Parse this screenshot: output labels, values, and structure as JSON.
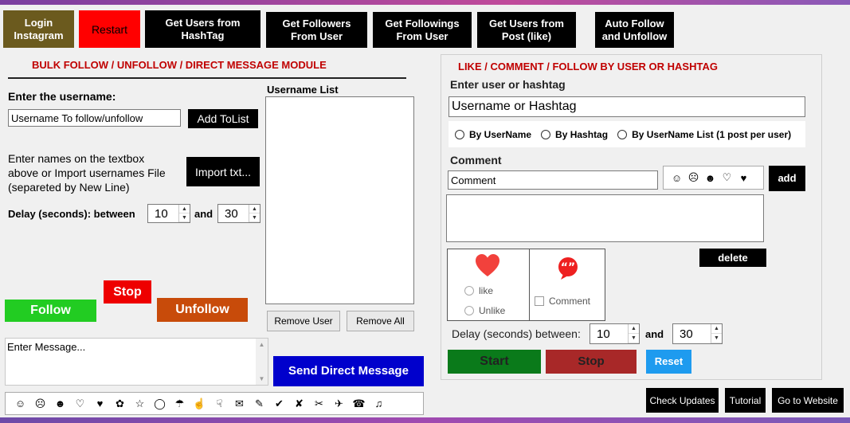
{
  "nav": {
    "login": "Login\nInstagram",
    "restart": "Restart",
    "users_hashtag": "Get Users from\nHashTag",
    "followers_user": "Get Followers\nFrom User",
    "followings_user": "Get Followings\nFrom User",
    "users_post": "Get Users from\nPost (like)",
    "auto_follow": "Auto Follow\nand Unfollow"
  },
  "bulk": {
    "heading": "BULK FOLLOW / UNFOLLOW / DIRECT MESSAGE MODULE",
    "enter_username_label": "Enter the username:",
    "username_value": "Username To follow/unfollow",
    "add_tolist": "Add ToList",
    "help_text": "Enter names on the textbox\nabove or Import usernames File\n(separeted by New Line)",
    "import_txt": "Import txt...",
    "delay_label": "Delay (seconds): between",
    "delay_from": "10",
    "and_label": "and",
    "delay_to": "30",
    "username_list_label": "Username List",
    "stop": "Stop",
    "follow": "Follow",
    "unfollow": "Unfollow",
    "remove_user": "Remove User",
    "remove_all": "Remove All",
    "message_value": "Enter Message...",
    "send_dm": "Send Direct Message",
    "emojis": [
      "☺",
      "☹",
      "☻",
      "♡",
      "♥",
      "✿",
      "☆",
      "◯",
      "☂",
      "☝",
      "☟",
      "✉",
      "✎",
      "✔",
      "✘",
      "✂",
      "✈",
      "☎",
      "♫"
    ]
  },
  "like": {
    "heading": "LIKE / COMMENT / FOLLOW BY USER OR HASHTAG",
    "enter_label": "Enter user or hashtag",
    "user_hashtag_value": "Username or Hashtag",
    "radio_username": "By UserName",
    "radio_hashtag": "By Hashtag",
    "radio_userlist": "By UserName List (1 post per user)",
    "comment_label": "Comment",
    "comment_value": "Comment",
    "comment_emojis": [
      "☺",
      "☹",
      "☻",
      "♡",
      "♥"
    ],
    "add": "add",
    "delete": "delete",
    "like_opt": "like",
    "unlike_opt": "Unlike",
    "comment_opt": "Comment",
    "delay_label": "Delay (seconds) between:",
    "delay_from": "10",
    "and_label": "and",
    "delay_to": "30",
    "start": "Start",
    "stop": "Stop",
    "reset": "Reset"
  },
  "footer": {
    "check_updates": "Check Updates",
    "tutorial": "Tutorial",
    "website": "Go to Website"
  },
  "colors": {
    "login_bg": "#6b5a1e",
    "restart_bg": "#ff0000",
    "heading_red": "#c00000",
    "follow_green": "#22cc22",
    "unfollow_orange": "#c84b0a",
    "stop_red": "#ee0000",
    "send_blue": "#0000cc",
    "start_green": "#0a7a1a",
    "stop2_red": "#a82828",
    "reset_blue": "#1e9bef"
  }
}
